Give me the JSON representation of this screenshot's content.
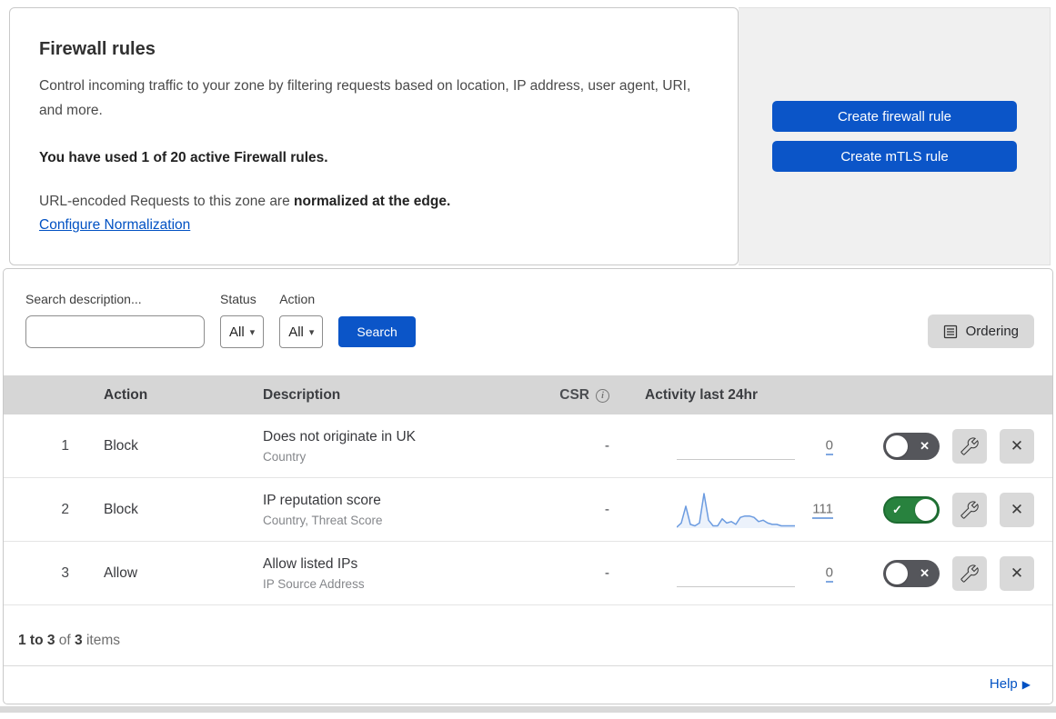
{
  "header": {
    "title": "Firewall rules",
    "description": "Control incoming traffic to your zone by filtering requests based on location, IP address, user agent, URI, and more.",
    "usage_notice": "You have used 1 of 20 active Firewall rules.",
    "normalization_prefix": "URL-encoded Requests to this zone are ",
    "normalization_bold": "normalized at the edge.",
    "normalization_link": "Configure Normalization"
  },
  "actions_panel": {
    "create_firewall_rule": "Create firewall rule",
    "create_mtls_rule": "Create mTLS rule"
  },
  "filters": {
    "search_label": "Search description...",
    "status_label": "Status",
    "status_value": "All",
    "action_label": "Action",
    "action_value": "All",
    "search_button": "Search",
    "ordering_button": "Ordering"
  },
  "table": {
    "headers": {
      "action": "Action",
      "description": "Description",
      "csr": "CSR",
      "activity": "Activity last 24hr"
    },
    "rows": [
      {
        "index": "1",
        "action": "Block",
        "description": "Does not originate in UK",
        "criteria": "Country",
        "csr": "-",
        "activity_count": "0",
        "enabled": false
      },
      {
        "index": "2",
        "action": "Block",
        "description": "IP reputation score",
        "criteria": "Country, Threat Score",
        "csr": "-",
        "activity_count": "111",
        "enabled": true,
        "sparkline": [
          0,
          3,
          15,
          2,
          1,
          3,
          24,
          5,
          1,
          1,
          6,
          3,
          4,
          2,
          7,
          8,
          8,
          7,
          4,
          5,
          3,
          2,
          2,
          1,
          1,
          1,
          1
        ]
      },
      {
        "index": "3",
        "action": "Allow",
        "description": "Allow listed IPs",
        "criteria": "IP Source Address",
        "csr": "-",
        "activity_count": "0",
        "enabled": false
      }
    ]
  },
  "footer": {
    "range": "1 to 3",
    "of_label": "of",
    "total": "3",
    "items_label": "items"
  },
  "help": {
    "label": "Help"
  },
  "icons": {
    "dropdown_arrow": "▾",
    "toggle_check": "✓",
    "toggle_cross": "✕",
    "delete_x": "✕",
    "help_arrow": "▶",
    "info": "i"
  },
  "colors": {
    "button_blue": "#0b55c8",
    "link_blue": "#0051c3",
    "toggle_on_green": "#28823e",
    "toggle_off_gray": "#55565b",
    "sparkline_blue": "#6b9be0",
    "panel_gray": "#f0f0f0",
    "table_header_gray": "#d6d6d6",
    "control_gray": "#d9d9d9"
  }
}
